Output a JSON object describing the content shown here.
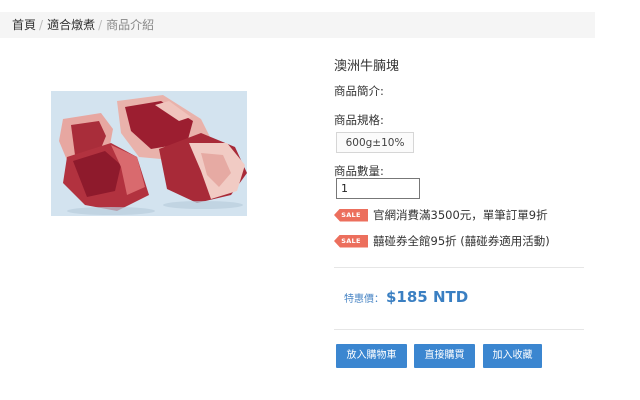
{
  "breadcrumb": {
    "items": [
      "首頁",
      "適合燉煮",
      "商品介紹"
    ],
    "separator": "/"
  },
  "product": {
    "title": "澳洲牛腩塊",
    "image_alt": "beef-cubes-photo",
    "intro_label": "商品簡介:",
    "spec_label": "商品規格:",
    "spec_option": "600g±10%",
    "qty_label": "商品數量:",
    "qty_value": "1"
  },
  "promotions": [
    {
      "tag": "SALE",
      "text": "官網消費滿3500元，單筆訂單9折"
    },
    {
      "tag": "SALE",
      "text": "囍碰券全館95折 (囍碰券適用活動)"
    }
  ],
  "price": {
    "label": "特惠價：",
    "value": "$185 NTD"
  },
  "buttons": {
    "add_to_cart": "放入購物車",
    "buy_now": "直接購買",
    "add_favorite": "加入收藏"
  },
  "colors": {
    "accent": "#3b86d0",
    "sale_tag": "#ec6f5d",
    "price": "#3a7fc2"
  }
}
